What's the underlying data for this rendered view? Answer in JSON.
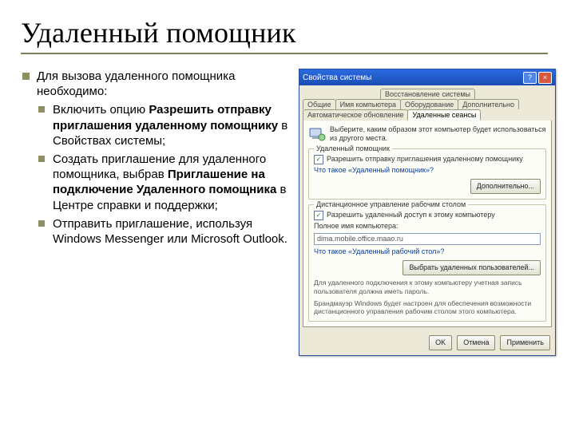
{
  "title": "Удаленный помощник",
  "main": {
    "lead": "Для вызова удаленного помощника необходимо:",
    "items": [
      {
        "pre": "Включить опцию ",
        "bold": "Разрешить отправку приглашения удаленному помощнику",
        "post": " в Свойствах системы;"
      },
      {
        "pre": "Создать приглашение для удаленного помощника, выбрав ",
        "bold": "Приглашение на подключение Удаленного помощника",
        "post": " в Центре справки и поддержки;"
      },
      {
        "pre": "Отправить приглашение, используя Windows Messenger или Microsoft Outlook.",
        "bold": "",
        "post": ""
      }
    ]
  },
  "dlg": {
    "title": "Свойства системы",
    "tabs_row1": [
      "Восстановление системы"
    ],
    "tabs_row2": [
      "Общие",
      "Имя компьютера",
      "Оборудование",
      "Дополнительно"
    ],
    "tabs_row3": [
      "Автоматическое обновление",
      "Удаленные сеансы"
    ],
    "intro": "Выберите, каким образом этот компьютер будет использоваться из другого места.",
    "group1": {
      "legend": "Удаленный помощник",
      "checkbox": "Разрешить отправку приглашения удаленному помощнику",
      "link": "Что такое «Удаленный помощник»?",
      "btn": "Дополнительно..."
    },
    "group2": {
      "legend": "Дистанционное управление рабочим столом",
      "checkbox": "Разрешить удаленный доступ к этому компьютеру",
      "label": "Полное имя компьютера:",
      "value": "dima.mobile.office.maao.ru",
      "link": "Что такое «Удаленный рабочий стол»?",
      "btn": "Выбрать удаленных пользователей...",
      "note1": "Для удаленного подключения к этому компьютеру учетная запись пользователя должна иметь пароль.",
      "note2": "Брандмауэр Windows будет настроен для обеспечения возможности дистанционного управления рабочим столом этого компьютера."
    },
    "footer": {
      "ok": "OK",
      "cancel": "Отмена",
      "apply": "Применить"
    }
  }
}
